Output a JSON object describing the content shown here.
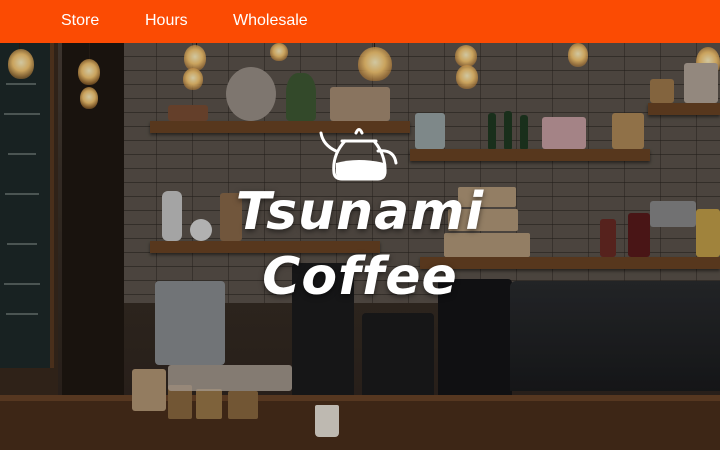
{
  "nav": {
    "background_color": "#fb4b03",
    "text_color": "#ffffff",
    "links": [
      {
        "label": "Store"
      },
      {
        "label": "Hours"
      },
      {
        "label": "Wholesale"
      }
    ]
  },
  "hero": {
    "logo_icon": "kettle-icon",
    "title_line_1": "Tsunami",
    "title_line_2": "Coffee",
    "title_color": "#ffffff"
  }
}
